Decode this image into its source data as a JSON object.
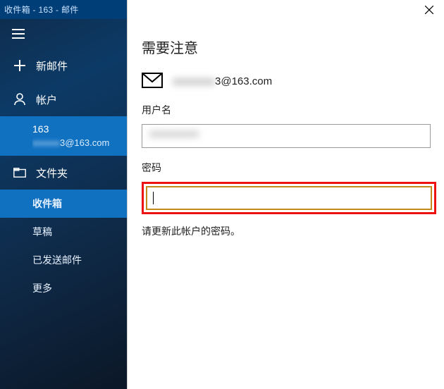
{
  "titlebar": "收件箱 - 163 - 邮件",
  "sidebar": {
    "new_mail": "新邮件",
    "accounts": "帐户",
    "account_selected": {
      "name": "163",
      "address_hidden": "xxxxxx",
      "address_suffix": "3@163.com"
    },
    "folders_label": "文件夹",
    "folders": [
      {
        "label": "收件箱",
        "active": true
      },
      {
        "label": "草稿",
        "active": false
      },
      {
        "label": "已发送邮件",
        "active": false
      },
      {
        "label": "更多",
        "active": false
      }
    ]
  },
  "panel": {
    "title": "需要注意",
    "email_hidden": "xxxxxxxx",
    "email_suffix": "3@163.com",
    "username_label": "用户名",
    "username_value_hidden": "xxxxxxxxxx",
    "password_label": "密码",
    "hint": "请更新此帐户的密码。"
  }
}
